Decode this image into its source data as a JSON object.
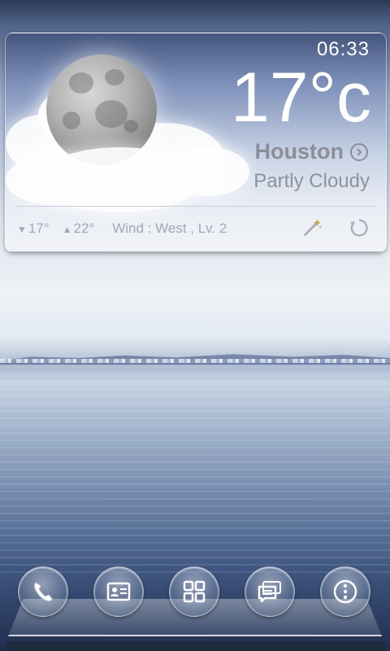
{
  "widget": {
    "time": "06:33",
    "temperature": "17°c",
    "city": "Houston",
    "condition": "Partly Cloudy",
    "low": "17°",
    "high": "22°",
    "wind": "Wind : West ,  Lv. 2"
  },
  "dock": {
    "icons": [
      "phone-icon",
      "contacts-icon",
      "app-drawer-icon",
      "messages-icon",
      "menu-icon"
    ]
  }
}
